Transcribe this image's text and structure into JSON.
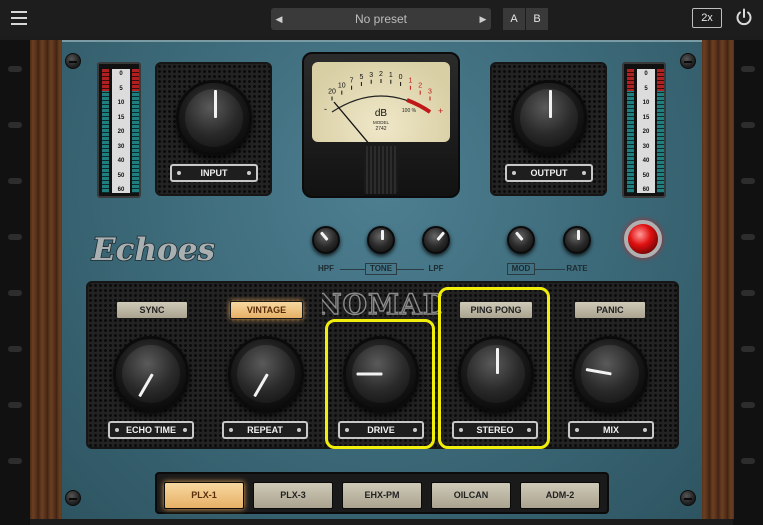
{
  "topbar": {
    "menu_icon": "hamburger-menu-icon",
    "preset_prev_icon": "triangle-left-icon",
    "preset_next_icon": "triangle-right-icon",
    "preset_name": "No preset",
    "a_label": "A",
    "b_label": "B",
    "zoom_label": "2x",
    "power_icon": "power-icon"
  },
  "vu": {
    "unit": "dB",
    "model_label": "MODEL",
    "model_number": "2742",
    "scale_black": [
      "20",
      "10",
      "7",
      "5",
      "3",
      "2",
      "1",
      "0"
    ],
    "scale_red": [
      "1",
      "2",
      "3"
    ],
    "percent_label": "100 %",
    "minus": "-",
    "plus": "+"
  },
  "meters": {
    "scale": [
      "0",
      "5",
      "10",
      "15",
      "20",
      "30",
      "40",
      "50",
      "60"
    ]
  },
  "knobs": {
    "input": "INPUT",
    "output": "OUTPUT",
    "echo_time": "ECHO TIME",
    "repeat": "REPEAT",
    "drive": "DRIVE",
    "stereo": "STEREO",
    "mix": "MIX"
  },
  "tone": {
    "hpf": "HPF",
    "tone": "TONE",
    "lpf": "LPF",
    "mod": "MOD",
    "rate": "RATE"
  },
  "logo": {
    "echoes": "Echoes",
    "nomad": "NOMAD"
  },
  "mode_buttons": {
    "sync": "SYNC",
    "vintage": "VINTAGE",
    "ping_pong": "PING PONG",
    "panic": "PANIC"
  },
  "models": [
    "PLX-1",
    "PLX-3",
    "EHX-PM",
    "OILCAN",
    "ADM-2"
  ],
  "selected_model": "PLX-1",
  "colors": {
    "panel": "#3b6877",
    "highlight": "#f2ee0c",
    "active_button": "#f7d8a0",
    "lamp": "#e01010"
  }
}
